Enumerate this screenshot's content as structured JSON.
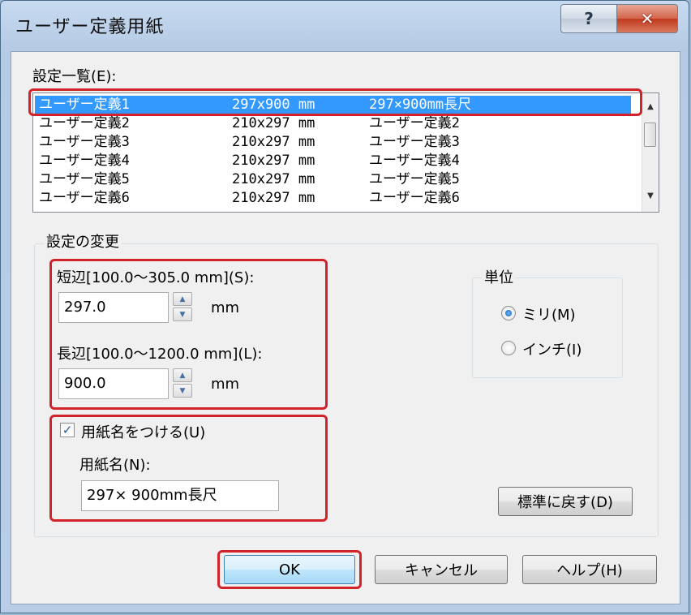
{
  "window": {
    "title": "ユーザー定義用紙",
    "help_label": "?",
    "close_label": "✕"
  },
  "settings_list": {
    "label": "設定一覧(E):",
    "rows": [
      {
        "name": "ユーザー定義1",
        "size": "297x900 mm",
        "paper": "297×900mm長尺",
        "selected": true
      },
      {
        "name": "ユーザー定義2",
        "size": "210x297 mm",
        "paper": "ユーザー定義2"
      },
      {
        "name": "ユーザー定義3",
        "size": "210x297 mm",
        "paper": "ユーザー定義3"
      },
      {
        "name": "ユーザー定義4",
        "size": "210x297 mm",
        "paper": "ユーザー定義4"
      },
      {
        "name": "ユーザー定義5",
        "size": "210x297 mm",
        "paper": "ユーザー定義5"
      },
      {
        "name": "ユーザー定義6",
        "size": "210x297 mm",
        "paper": "ユーザー定義6"
      }
    ]
  },
  "change": {
    "legend": "設定の変更",
    "short_side": {
      "label": "短辺[100.0～305.0 mm](S):",
      "value": "297.0",
      "unit": "mm"
    },
    "long_side": {
      "label": "長辺[100.0～1200.0 mm](L):",
      "value": "900.0",
      "unit": "mm"
    },
    "name_check": {
      "label": "用紙名をつける(U)",
      "checked": true
    },
    "paper_name": {
      "label": "用紙名(N):",
      "value": "297× 900mm長尺"
    },
    "reset_label": "標準に戻す(D)"
  },
  "unit": {
    "legend": "単位",
    "options": [
      {
        "label": "ミリ(M)",
        "selected": true
      },
      {
        "label": "インチ(I)",
        "selected": false
      }
    ]
  },
  "buttons": {
    "ok": "OK",
    "cancel": "キャンセル",
    "help": "ヘルプ(H)"
  },
  "colors": {
    "selection": "#3399ff",
    "highlight": "#d3232a",
    "titlebar": "#b9cde6"
  }
}
